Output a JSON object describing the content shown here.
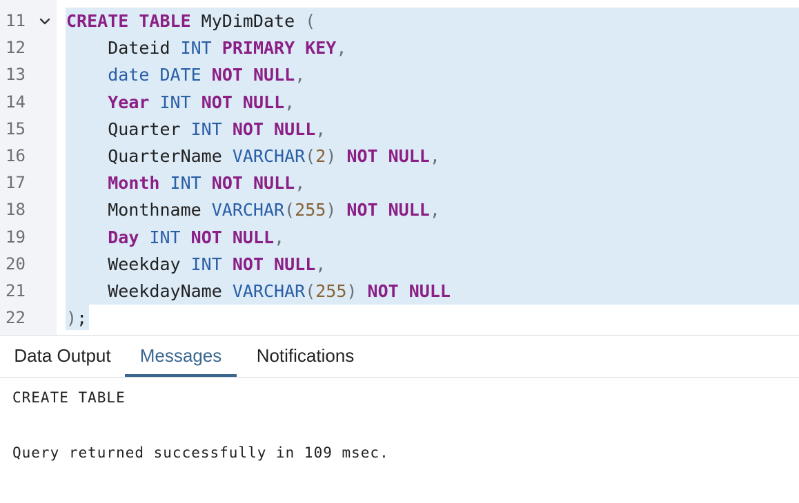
{
  "editor": {
    "line_numbers": [
      "11",
      "12",
      "13",
      "14",
      "15",
      "16",
      "17",
      "18",
      "19",
      "20",
      "21",
      "22"
    ],
    "lines": [
      [
        {
          "t": "CREATE TABLE",
          "c": "kw"
        },
        {
          "t": " MyDimDate ",
          "c": "id"
        },
        {
          "t": "(",
          "c": "pn"
        }
      ],
      [
        {
          "t": "    Dateid ",
          "c": "id"
        },
        {
          "t": "INT",
          "c": "ty"
        },
        {
          "t": " ",
          "c": "id"
        },
        {
          "t": "PRIMARY KEY",
          "c": "kw"
        },
        {
          "t": ",",
          "c": "pn"
        }
      ],
      [
        {
          "t": "    ",
          "c": "id"
        },
        {
          "t": "date",
          "c": "blue-id"
        },
        {
          "t": " ",
          "c": "id"
        },
        {
          "t": "DATE",
          "c": "ty"
        },
        {
          "t": " ",
          "c": "id"
        },
        {
          "t": "NOT NULL",
          "c": "kw"
        },
        {
          "t": ",",
          "c": "pn"
        }
      ],
      [
        {
          "t": "    ",
          "c": "id"
        },
        {
          "t": "Year",
          "c": "kw"
        },
        {
          "t": " ",
          "c": "id"
        },
        {
          "t": "INT",
          "c": "ty"
        },
        {
          "t": " ",
          "c": "id"
        },
        {
          "t": "NOT NULL",
          "c": "kw"
        },
        {
          "t": ",",
          "c": "pn"
        }
      ],
      [
        {
          "t": "    Quarter ",
          "c": "id"
        },
        {
          "t": "INT",
          "c": "ty"
        },
        {
          "t": " ",
          "c": "id"
        },
        {
          "t": "NOT NULL",
          "c": "kw"
        },
        {
          "t": ",",
          "c": "pn"
        }
      ],
      [
        {
          "t": "    QuarterName ",
          "c": "id"
        },
        {
          "t": "VARCHAR",
          "c": "ty"
        },
        {
          "t": "(",
          "c": "pn"
        },
        {
          "t": "2",
          "c": "num"
        },
        {
          "t": ")",
          "c": "pn"
        },
        {
          "t": " ",
          "c": "id"
        },
        {
          "t": "NOT NULL",
          "c": "kw"
        },
        {
          "t": ",",
          "c": "pn"
        }
      ],
      [
        {
          "t": "    ",
          "c": "id"
        },
        {
          "t": "Month",
          "c": "kw"
        },
        {
          "t": " ",
          "c": "id"
        },
        {
          "t": "INT",
          "c": "ty"
        },
        {
          "t": " ",
          "c": "id"
        },
        {
          "t": "NOT NULL",
          "c": "kw"
        },
        {
          "t": ",",
          "c": "pn"
        }
      ],
      [
        {
          "t": "    Monthname ",
          "c": "id"
        },
        {
          "t": "VARCHAR",
          "c": "ty"
        },
        {
          "t": "(",
          "c": "pn"
        },
        {
          "t": "255",
          "c": "num"
        },
        {
          "t": ")",
          "c": "pn"
        },
        {
          "t": " ",
          "c": "id"
        },
        {
          "t": "NOT NULL",
          "c": "kw"
        },
        {
          "t": ",",
          "c": "pn"
        }
      ],
      [
        {
          "t": "    ",
          "c": "id"
        },
        {
          "t": "Day",
          "c": "kw"
        },
        {
          "t": " ",
          "c": "id"
        },
        {
          "t": "INT",
          "c": "ty"
        },
        {
          "t": " ",
          "c": "id"
        },
        {
          "t": "NOT NULL",
          "c": "kw"
        },
        {
          "t": ",",
          "c": "pn"
        }
      ],
      [
        {
          "t": "    Weekday ",
          "c": "id"
        },
        {
          "t": "INT",
          "c": "ty"
        },
        {
          "t": " ",
          "c": "id"
        },
        {
          "t": "NOT NULL",
          "c": "kw"
        },
        {
          "t": ",",
          "c": "pn"
        }
      ],
      [
        {
          "t": "    WeekdayName ",
          "c": "id"
        },
        {
          "t": "VARCHAR",
          "c": "ty"
        },
        {
          "t": "(",
          "c": "pn"
        },
        {
          "t": "255",
          "c": "num"
        },
        {
          "t": ")",
          "c": "pn"
        },
        {
          "t": " ",
          "c": "id"
        },
        {
          "t": "NOT NULL",
          "c": "kw"
        }
      ],
      [
        {
          "t": ")",
          "c": "pn"
        },
        {
          "t": ";",
          "c": "id"
        }
      ]
    ],
    "fold_icon": "chevron-down-icon",
    "colors": {
      "keyword": "#8b1f86",
      "type": "#2a5ea6",
      "number": "#8a6236",
      "selection": "#dcebf6",
      "gutter": "#f3f4f7"
    }
  },
  "tabs": {
    "data_output": "Data Output",
    "messages": "Messages",
    "notifications": "Notifications",
    "active": "Messages",
    "active_color": "#3a6690"
  },
  "output": {
    "line1": "CREATE TABLE",
    "line2": "Query returned successfully in 109 msec."
  }
}
